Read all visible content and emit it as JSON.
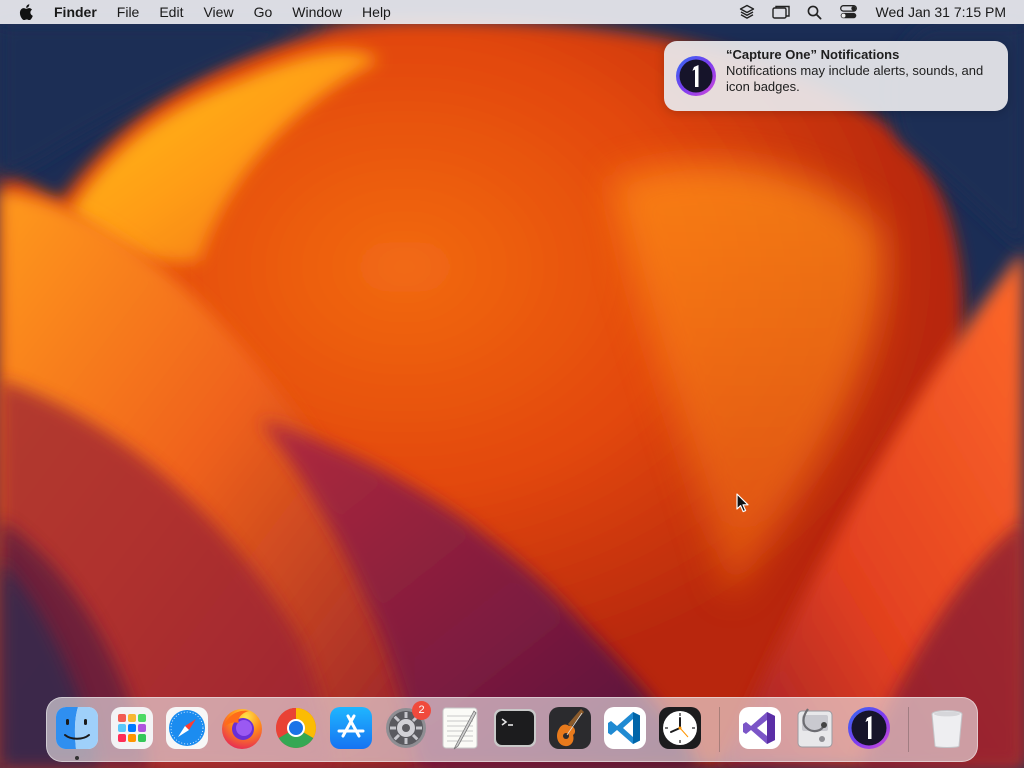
{
  "menubar": {
    "app_name": "Finder",
    "items": [
      {
        "label": "File"
      },
      {
        "label": "Edit"
      },
      {
        "label": "View"
      },
      {
        "label": "Go"
      },
      {
        "label": "Window"
      },
      {
        "label": "Help"
      }
    ],
    "status_icons": [
      "layers-icon",
      "screen-mirroring-icon",
      "spotlight-search-icon",
      "control-center-icon"
    ],
    "clock": "Wed Jan 31  7:15 PM"
  },
  "notification": {
    "title": "“Capture One” Notifications",
    "body": "Notifications may include alerts, sounds, and icon badges.",
    "icon": "capture-one-icon"
  },
  "dock": {
    "apps": [
      {
        "name": "Finder",
        "icon": "finder-icon",
        "running": true
      },
      {
        "name": "Launchpad",
        "icon": "launchpad-icon",
        "running": false
      },
      {
        "name": "Safari",
        "icon": "safari-icon",
        "running": false
      },
      {
        "name": "Firefox",
        "icon": "firefox-icon",
        "running": false
      },
      {
        "name": "Google Chrome",
        "icon": "chrome-icon",
        "running": false
      },
      {
        "name": "App Store",
        "icon": "app-store-icon",
        "running": false
      },
      {
        "name": "System Settings",
        "icon": "system-settings-icon",
        "running": false,
        "badge": "2"
      },
      {
        "name": "TextEdit",
        "icon": "textedit-icon",
        "running": false
      },
      {
        "name": "Terminal",
        "icon": "terminal-icon",
        "running": false
      },
      {
        "name": "GarageBand",
        "icon": "garageband-icon",
        "running": false
      },
      {
        "name": "Visual Studio Code",
        "icon": "vscode-icon",
        "running": false
      },
      {
        "name": "Clock",
        "icon": "clock-icon",
        "running": false
      },
      {
        "name": "Visual Studio",
        "icon": "visual-studio-icon",
        "running": false
      },
      {
        "name": "Disk Utility",
        "icon": "disk-utility-icon",
        "running": false
      },
      {
        "name": "Capture One",
        "icon": "capture-one-icon",
        "running": false
      },
      {
        "name": "Trash",
        "icon": "trash-icon",
        "running": false
      }
    ]
  }
}
